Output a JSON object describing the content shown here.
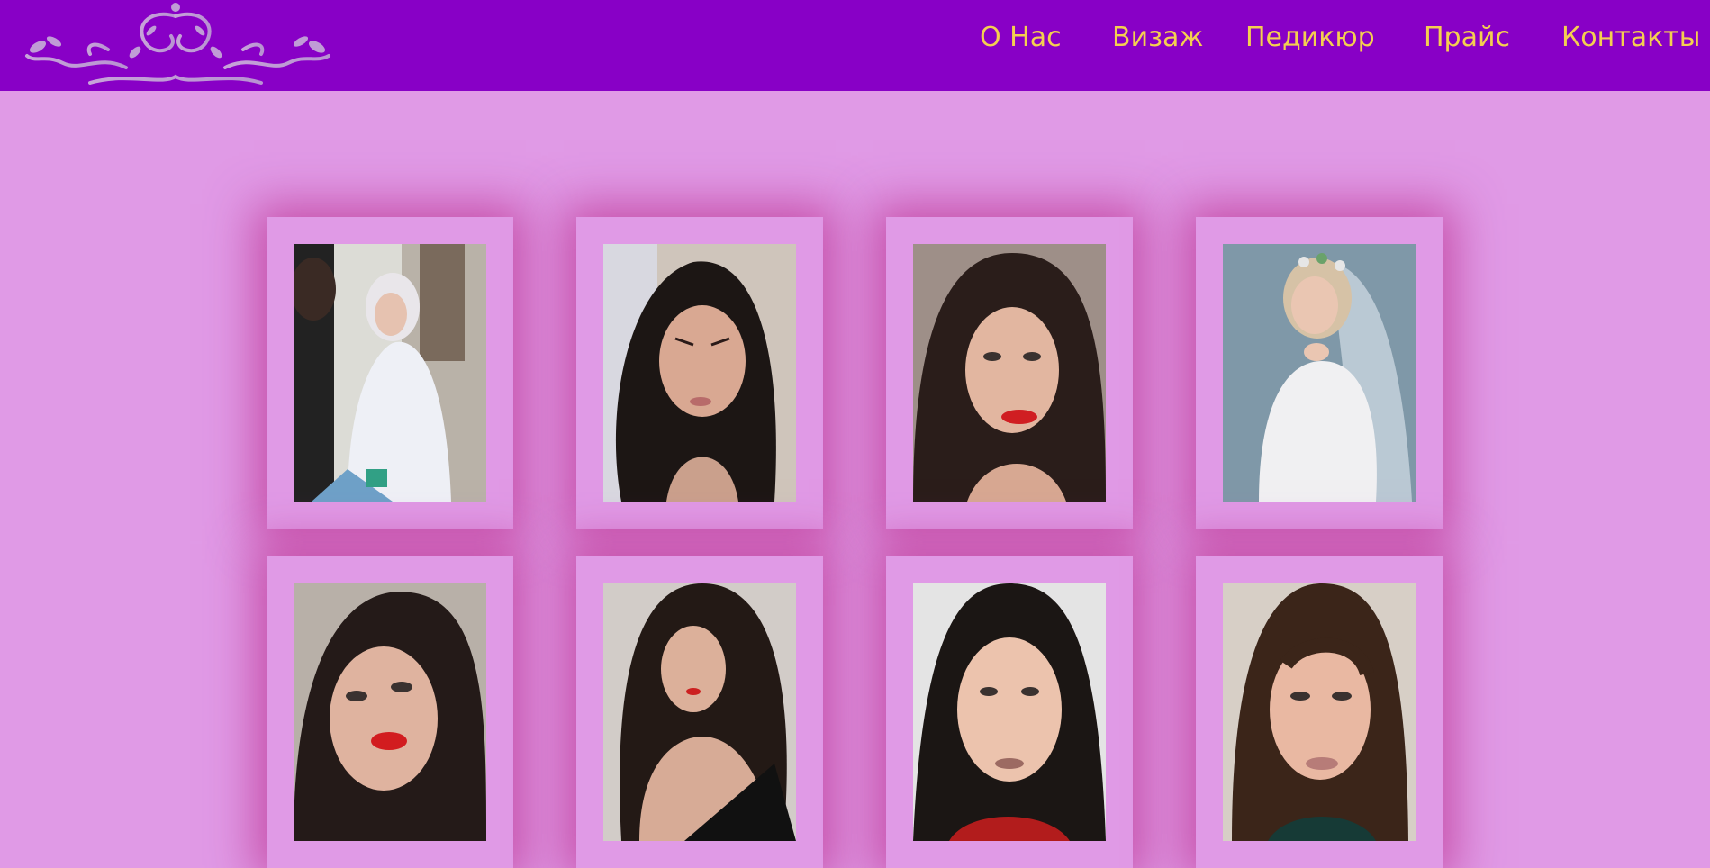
{
  "header": {
    "logo_icon": "floral-ornament-icon",
    "nav": [
      {
        "label": "О Нас"
      },
      {
        "label": "Визаж"
      },
      {
        "label": "Педикюр"
      },
      {
        "label": "Прайс"
      },
      {
        "label": "Контакты"
      }
    ]
  },
  "colors": {
    "header_bg": "#8800c6",
    "page_bg": "#e09ae6",
    "nav_text": "#f4cf50",
    "frame_shadow": "#be3796"
  },
  "gallery": {
    "photos": [
      {
        "subject": "makeup-artist-bride-photo"
      },
      {
        "subject": "dark-hair-portrait-photo"
      },
      {
        "subject": "red-lips-portrait-photo"
      },
      {
        "subject": "bride-veil-portrait-photo"
      },
      {
        "subject": "red-lips-closeup-photo"
      },
      {
        "subject": "black-dress-portrait-photo"
      },
      {
        "subject": "natural-makeup-portrait-photo"
      },
      {
        "subject": "nude-lips-portrait-photo"
      }
    ]
  }
}
